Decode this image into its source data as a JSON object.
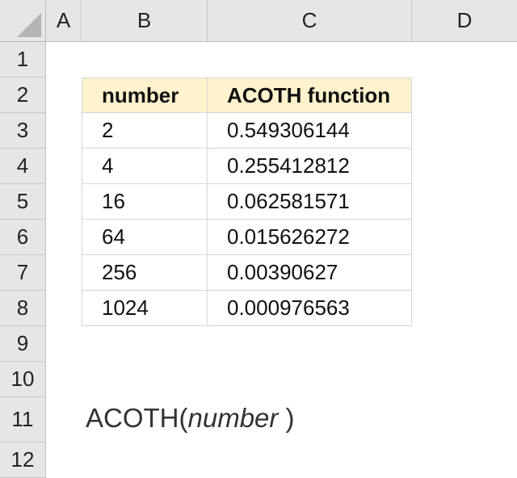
{
  "columns": [
    "A",
    "B",
    "C",
    "D"
  ],
  "rows": [
    "1",
    "2",
    "3",
    "4",
    "5",
    "6",
    "7",
    "8",
    "9",
    "10",
    "11",
    "12"
  ],
  "table": {
    "headers": [
      "number",
      "ACOTH function"
    ],
    "rows": [
      [
        "2",
        "0.549306144"
      ],
      [
        "4",
        "0.255412812"
      ],
      [
        "16",
        "0.062581571"
      ],
      [
        "64",
        "0.015626272"
      ],
      [
        "256",
        "0.00390627"
      ],
      [
        "1024",
        "0.000976563"
      ]
    ]
  },
  "formula": {
    "name": "ACOTH(",
    "arg": "number",
    "close": " )"
  },
  "colors": {
    "header_fill": "#fff2cc",
    "grid_header_bg": "#e6e6e6"
  }
}
